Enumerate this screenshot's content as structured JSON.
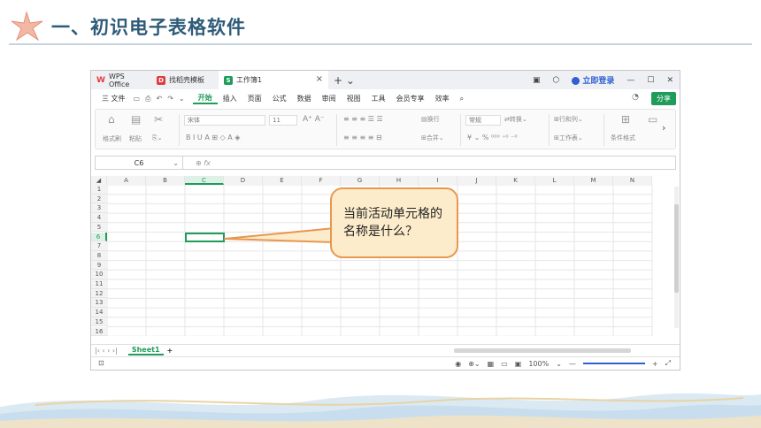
{
  "slide": {
    "title": "一、初识电子表格软件"
  },
  "window": {
    "tabs": [
      {
        "label": "WPS Office"
      },
      {
        "label": "找稻壳模板"
      },
      {
        "label": "工作簿1"
      }
    ],
    "login_label": "立即登录"
  },
  "menu": {
    "file_label": "三 文件",
    "items": [
      "开始",
      "插入",
      "页面",
      "公式",
      "数据",
      "审阅",
      "视图",
      "工具",
      "会员专享",
      "效率"
    ],
    "share_label": "分享"
  },
  "ribbon": {
    "format_painter": "格式刷",
    "paste": "粘贴",
    "font_name": "宋体",
    "font_size": "11",
    "wrap": "换行",
    "merge": "合并",
    "number_format": "常规",
    "convert": "转换",
    "row_col": "行和列",
    "worksheet": "工作表",
    "cond_format": "条件格式"
  },
  "formula_bar": {
    "name_box": "C6",
    "fx": "fx"
  },
  "grid": {
    "columns": [
      "A",
      "B",
      "C",
      "D",
      "E",
      "F",
      "G",
      "H",
      "I",
      "J",
      "K",
      "L",
      "M",
      "N"
    ],
    "rows": [
      "1",
      "2",
      "3",
      "4",
      "5",
      "6",
      "7",
      "8",
      "9",
      "10",
      "11",
      "12",
      "13",
      "14",
      "15",
      "16"
    ],
    "active_column": "C",
    "active_row": "6"
  },
  "sheet_tabs": {
    "active": "Sheet1"
  },
  "status": {
    "zoom": "100%"
  },
  "callout": {
    "text": "当前活动单元格的名称是什么？"
  },
  "colors": {
    "accent_green": "#1f9b5a",
    "title_blue": "#2d5b78",
    "callout_fill": "#fdeccb",
    "callout_border": "#e8974e"
  }
}
